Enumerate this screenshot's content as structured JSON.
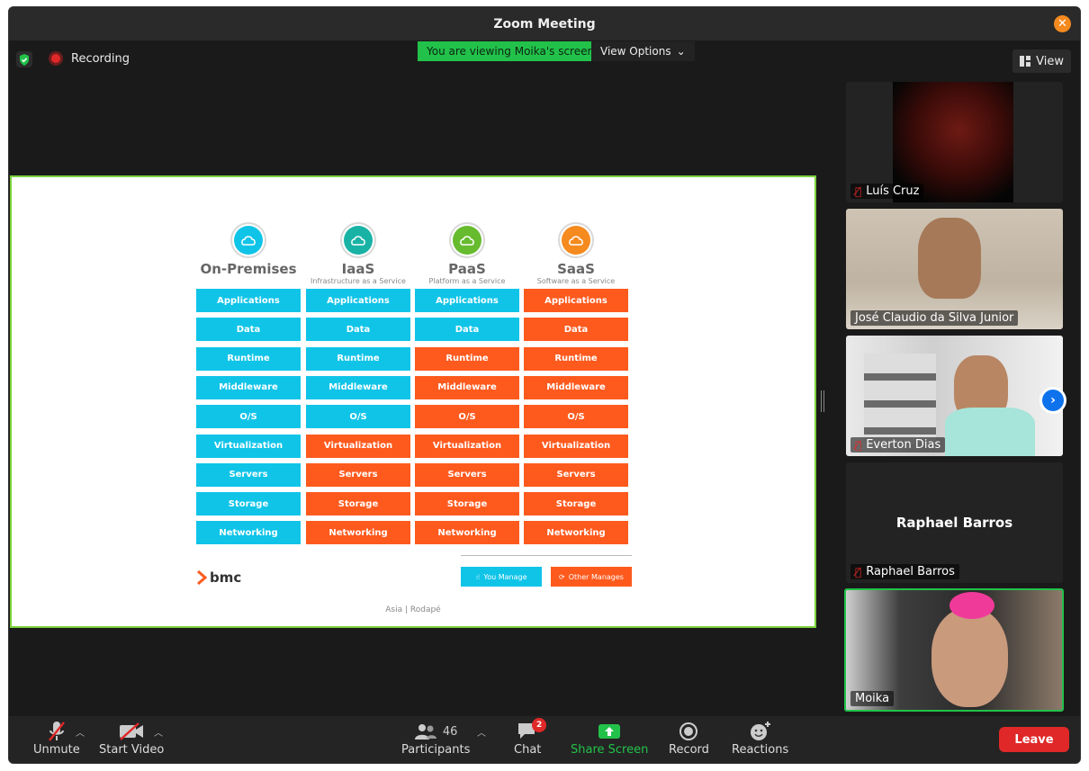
{
  "window": {
    "title": "Zoom Meeting"
  },
  "status": {
    "recording_label": "Recording"
  },
  "share": {
    "viewing_text": "You are viewing Moika's screen",
    "view_options_label": "View Options"
  },
  "view_button_label": "View",
  "slide": {
    "columns": [
      {
        "name": "On-Premises",
        "subtitle": ""
      },
      {
        "name": "IaaS",
        "subtitle": "Infrastructure as a Service"
      },
      {
        "name": "PaaS",
        "subtitle": "Platform as a Service"
      },
      {
        "name": "SaaS",
        "subtitle": "Software as a Service"
      }
    ],
    "rows": [
      {
        "label": "Applications",
        "managed": [
          "you",
          "you",
          "you",
          "other"
        ]
      },
      {
        "label": "Data",
        "managed": [
          "you",
          "you",
          "you",
          "other"
        ]
      },
      {
        "label": "Runtime",
        "managed": [
          "you",
          "you",
          "other",
          "other"
        ]
      },
      {
        "label": "Middleware",
        "managed": [
          "you",
          "you",
          "other",
          "other"
        ]
      },
      {
        "label": "O/S",
        "managed": [
          "you",
          "you",
          "other",
          "other"
        ]
      },
      {
        "label": "Virtualization",
        "managed": [
          "you",
          "other",
          "other",
          "other"
        ]
      },
      {
        "label": "Servers",
        "managed": [
          "you",
          "other",
          "other",
          "other"
        ]
      },
      {
        "label": "Storage",
        "managed": [
          "you",
          "other",
          "other",
          "other"
        ]
      },
      {
        "label": "Networking",
        "managed": [
          "you",
          "other",
          "other",
          "other"
        ]
      }
    ],
    "legend": {
      "you_manage": "You Manage",
      "other_manages": "Other Manages"
    },
    "logo_text": "bmc",
    "footer": "Asia | Rodapé",
    "colors": {
      "you": "#10c4e8",
      "other": "#fe5a1e"
    }
  },
  "participants_panel": {
    "tiles": [
      {
        "name": "Luís Cruz",
        "muted": true
      },
      {
        "name": "José Claudio da Silva Junior",
        "muted": false
      },
      {
        "name": "Everton Dias",
        "muted": true
      },
      {
        "name": "Raphael Barros",
        "muted": true,
        "display_name": "Raphael Barros"
      },
      {
        "name": "Moika",
        "muted": false,
        "active_speaker": true
      }
    ]
  },
  "toolbar": {
    "unmute": "Unmute",
    "start_video": "Start Video",
    "participants": "Participants",
    "participants_count": "46",
    "chat": "Chat",
    "chat_badge": "2",
    "share_screen": "Share Screen",
    "record": "Record",
    "reactions": "Reactions",
    "leave": "Leave"
  }
}
